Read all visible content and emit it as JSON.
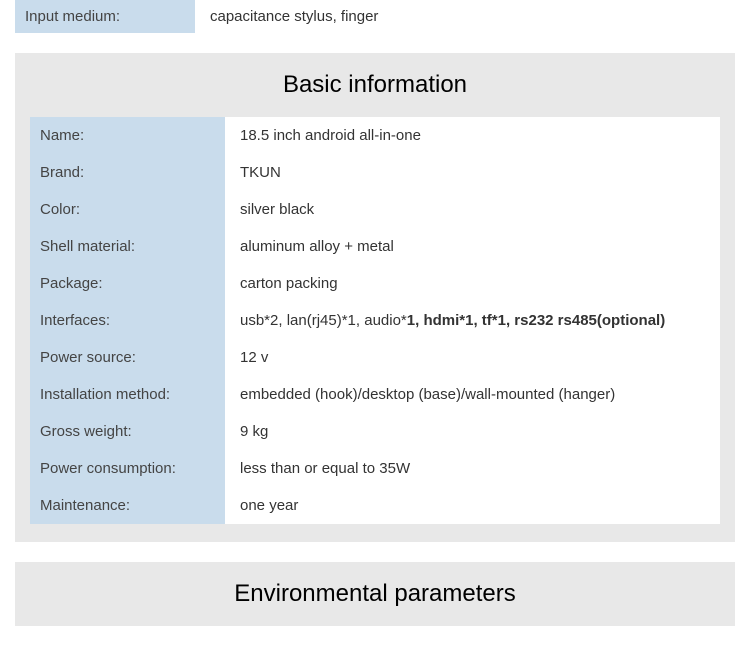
{
  "top_row": {
    "label": "Input medium:",
    "value": "capacitance stylus, finger"
  },
  "basic_info": {
    "title": "Basic information",
    "rows": [
      {
        "label": "Name:",
        "value": "18.5 inch android all-in-one"
      },
      {
        "label": "Brand:",
        "value": "TKUN"
      },
      {
        "label": "Color:",
        "value": "silver black"
      },
      {
        "label": "Shell material:",
        "value": "aluminum alloy + metal"
      },
      {
        "label": "Package:",
        "value": " carton packing"
      },
      {
        "label": "Interfaces:",
        "value_parts": [
          {
            "text": "usb*2, lan(rj45)*1, audio*",
            "bold": false
          },
          {
            "text": "1, hdmi*1, tf*1, rs232 rs485(optional)",
            "bold": true
          }
        ]
      },
      {
        "label": "Power source:",
        "value": " 12 v"
      },
      {
        "label": "Installation method:",
        "value": "  embedded (hook)/desktop (base)/wall-mounted (hanger)"
      },
      {
        "label": "Gross weight:",
        "value": " 9 kg"
      },
      {
        "label": "Power consumption:",
        "value": "  less than or equal to 35W"
      },
      {
        "label": "Maintenance:",
        "value": "  one year"
      }
    ]
  },
  "environmental": {
    "title": "Environmental parameters"
  }
}
